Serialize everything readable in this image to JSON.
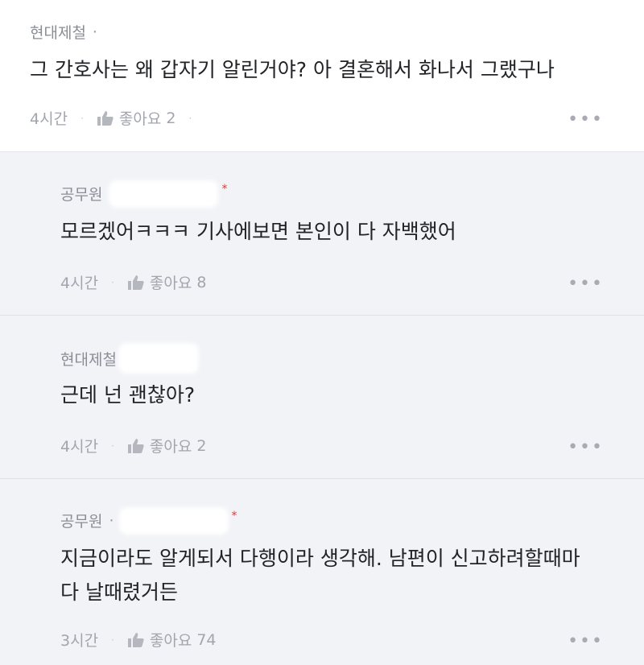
{
  "comments": [
    {
      "author": "현대제철",
      "dot": "·",
      "lines": [
        "그 간호사는 왜 갑자기 알린거야? 아 결혼해서 화나서 그랬구나"
      ],
      "time": "4시간",
      "like_label": "좋아요",
      "likes": "2",
      "more": "•••",
      "icon": "thumbs-up-icon"
    }
  ],
  "replies": [
    {
      "author": "공무원",
      "star": "*",
      "lines": [
        "모르겠어ㅋㅋㅋ 기사에보면 본인이 다 자백했어"
      ],
      "time": "4시간",
      "like_label": "좋아요",
      "likes": "8",
      "more": "•••"
    },
    {
      "author": "현대제철",
      "lines": [
        "근데 넌 괜찮아?"
      ],
      "time": "4시간",
      "like_label": "좋아요",
      "likes": "2",
      "more": "•••"
    },
    {
      "author": "공무원",
      "dot": "·",
      "star": "*",
      "lines": [
        "지금이라도 알게되서 다행이라 생각해. 남편이 신고하려할때마",
        "다 날때렸거든"
      ],
      "time": "3시간",
      "like_label": "좋아요",
      "likes": "74",
      "more": "•••"
    }
  ],
  "colors": {
    "reply_bg": "#f2f3f7",
    "star": "#d0403c",
    "meta": "#8a8d96"
  }
}
